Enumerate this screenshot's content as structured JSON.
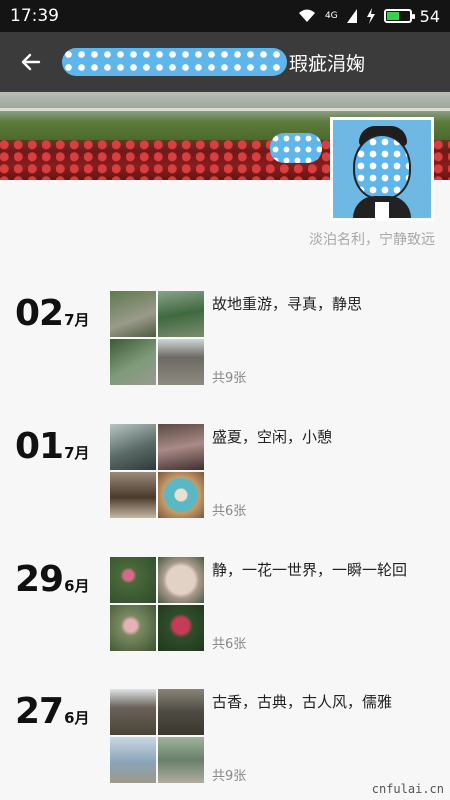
{
  "status_bar": {
    "time": "17:39",
    "network": "4G",
    "battery": "54",
    "battery_level": 0.54
  },
  "nav": {
    "back_icon": "arrow-left-icon",
    "title": "瑕疵涓婅"
  },
  "profile": {
    "signature": "淡泊名利，宁静致远"
  },
  "entries": [
    {
      "day": "02",
      "month": "7月",
      "caption": "故地重游，寻真，静思",
      "count": "共9张"
    },
    {
      "day": "01",
      "month": "7月",
      "caption": "盛夏，空闲，小憩",
      "count": "共6张"
    },
    {
      "day": "29",
      "month": "6月",
      "caption": "静，一花一世界，一瞬一轮回",
      "count": "共6张"
    },
    {
      "day": "27",
      "month": "6月",
      "caption": "古香，古典，古人风，儒雅",
      "count": "共9张"
    }
  ],
  "watermark": "cnfulai.cn",
  "colors": {
    "status_bar": "#141414",
    "nav_bar": "#3b3b3b",
    "background": "#f7f7f7",
    "blur_blue": "#5fb6ea"
  }
}
